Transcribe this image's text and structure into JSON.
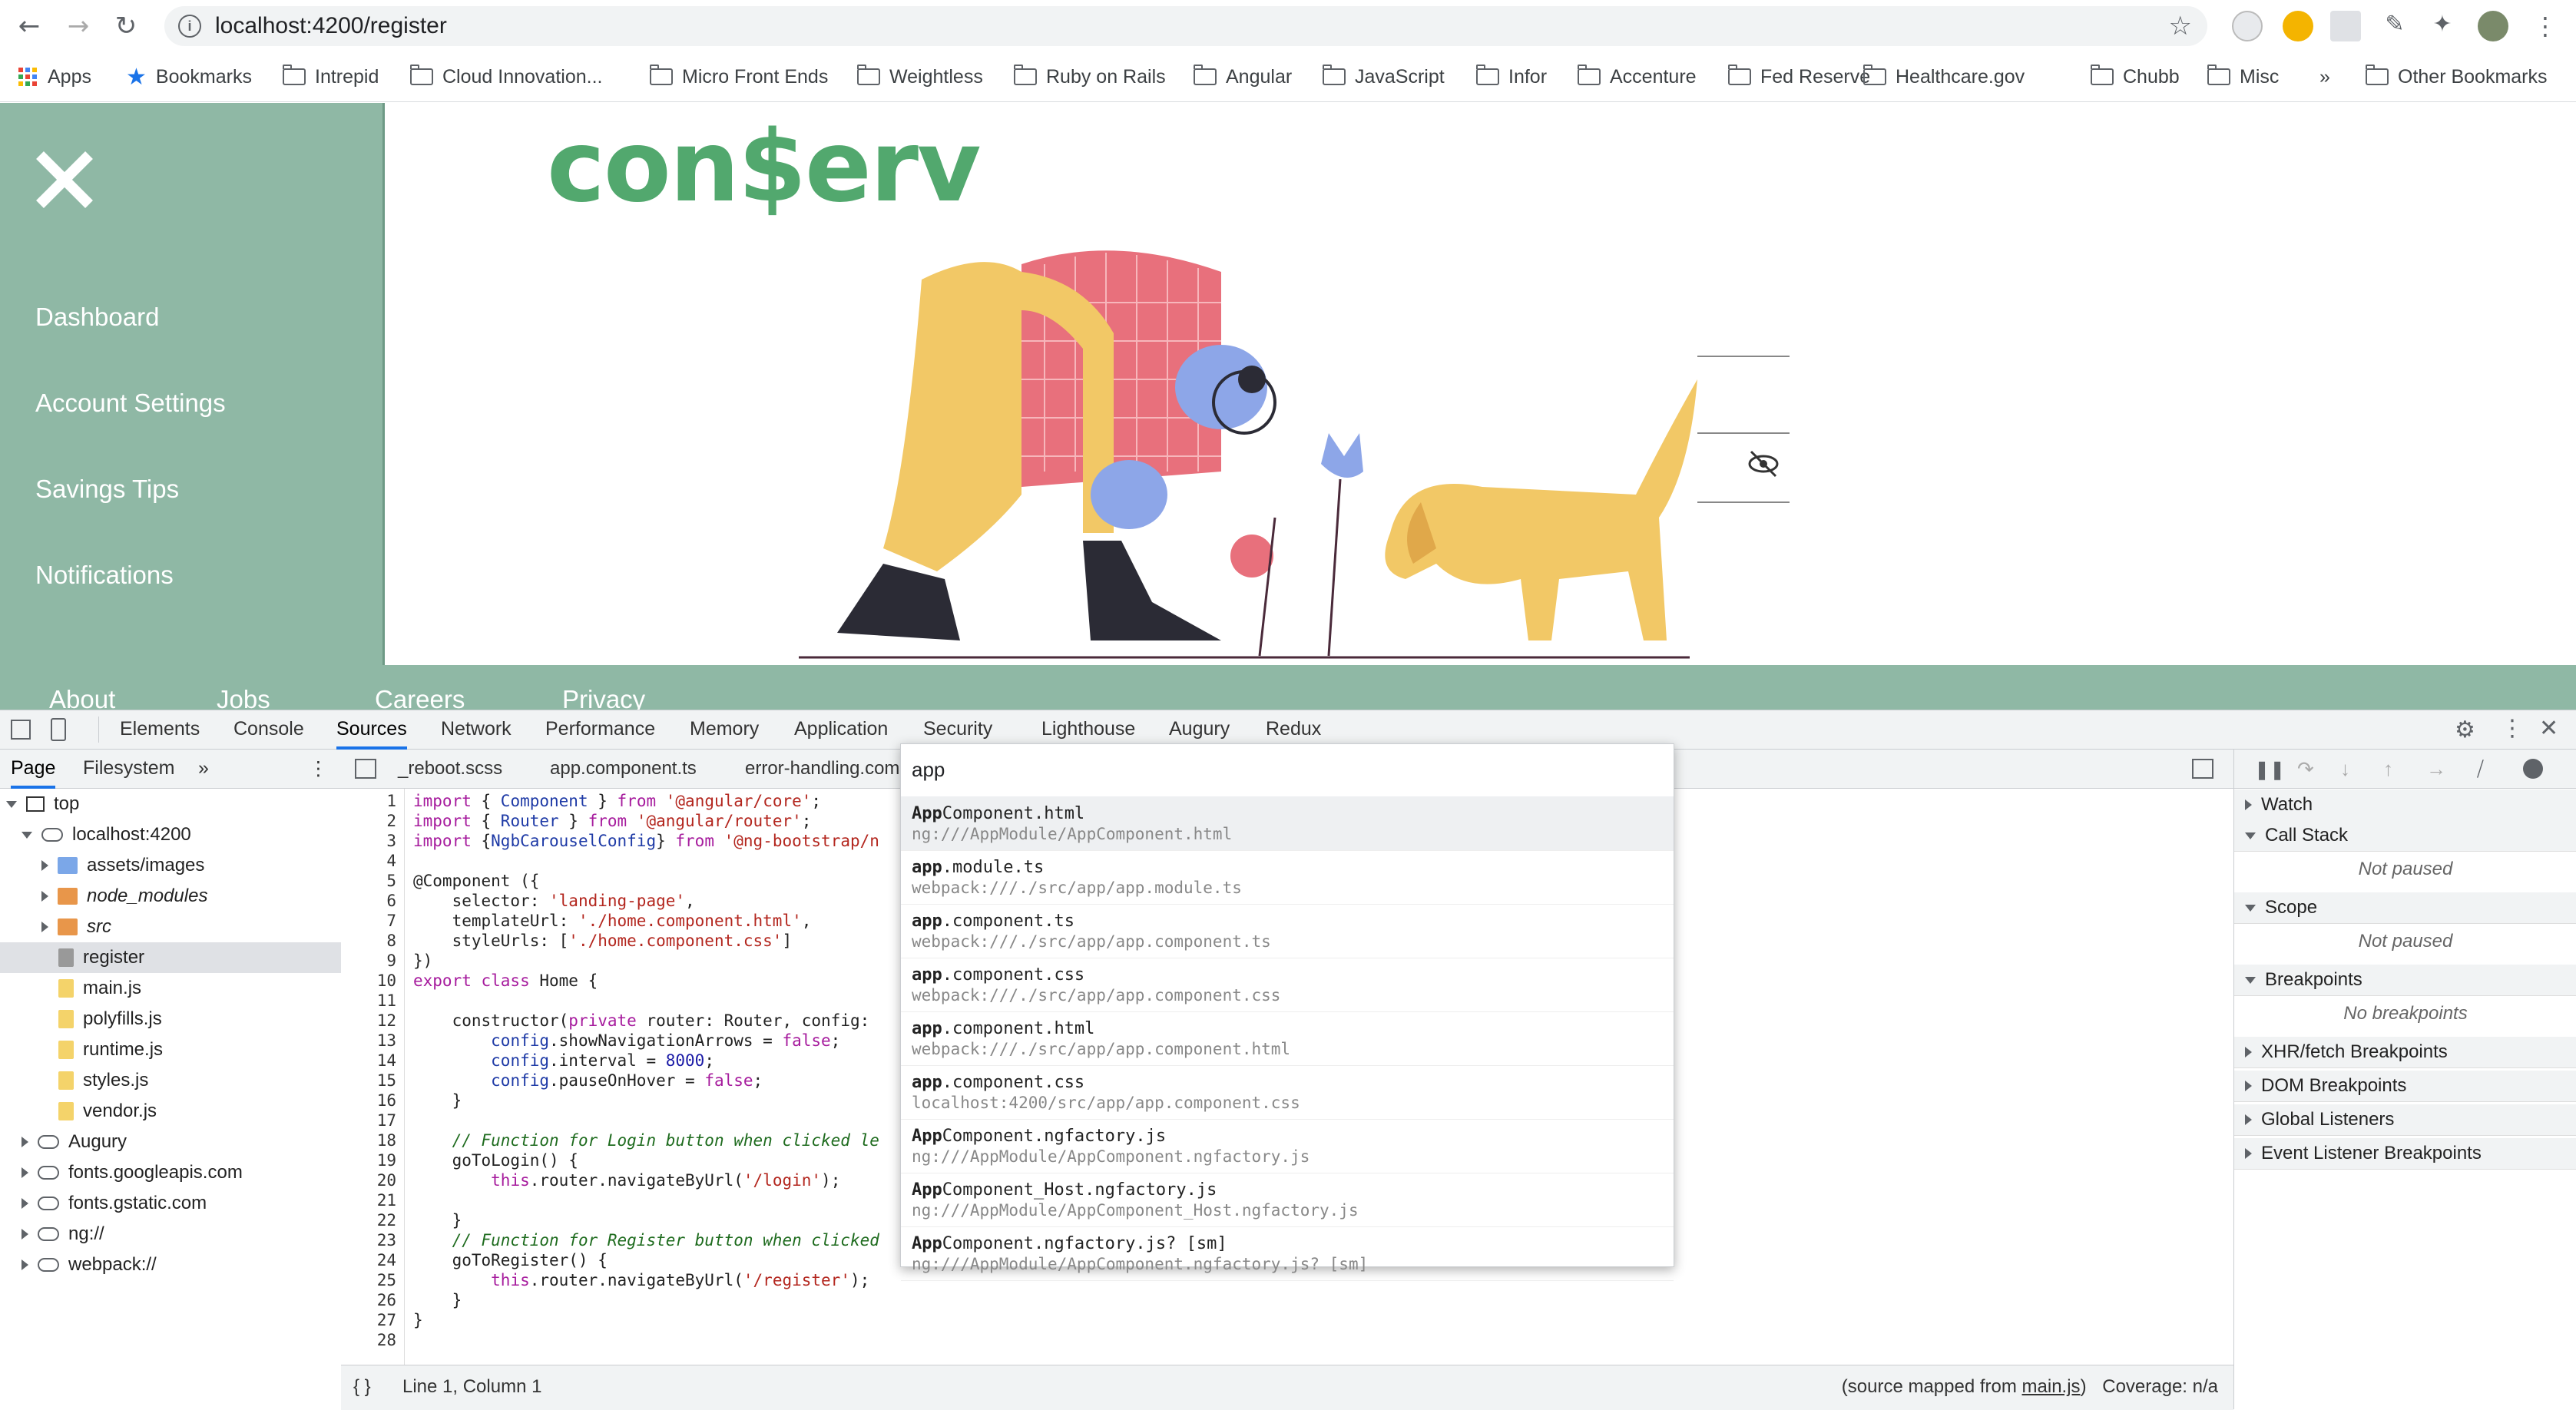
{
  "browser": {
    "url": "localhost:4200/register",
    "bookmarks": [
      "Apps",
      "Bookmarks",
      "Intrepid",
      "Cloud Innovation...",
      "Micro Front Ends",
      "Weightless",
      "Ruby on Rails",
      "Angular",
      "JavaScript",
      "Infor",
      "Accenture",
      "Fed Reserve",
      "Healthcare.gov",
      "Chubb",
      "Misc"
    ],
    "more_bookmarks": "»",
    "other_bookmarks": "Other Bookmarks"
  },
  "page": {
    "logo": "con$erv",
    "nav": [
      "Dashboard",
      "Account Settings",
      "Savings Tips",
      "Notifications"
    ],
    "footer": [
      "About",
      "Jobs",
      "Careers",
      "Privacy"
    ]
  },
  "devtools": {
    "tabs": [
      "Elements",
      "Console",
      "Sources",
      "Network",
      "Performance",
      "Memory",
      "Application",
      "Security",
      "Lighthouse",
      "Augury",
      "Redux"
    ],
    "active_tab": "Sources",
    "left_tabs": [
      "Page",
      "Filesystem"
    ],
    "left_more": "»",
    "tree": {
      "top": "top",
      "host": "localhost:4200",
      "folders": [
        "assets/images",
        "node_modules",
        "src"
      ],
      "files": [
        "register",
        "main.js",
        "polyfills.js",
        "runtime.js",
        "styles.js",
        "vendor.js"
      ],
      "origins": [
        "Augury",
        "fonts.googleapis.com",
        "fonts.gstatic.com",
        "ng://",
        "webpack://"
      ]
    },
    "editor_tabs": [
      "_reboot.scss",
      "app.component.ts",
      "error-handling.com"
    ],
    "code_lines": [
      "1",
      "2",
      "3",
      "4",
      "5",
      "6",
      "7",
      "8",
      "9",
      "10",
      "11",
      "12",
      "13",
      "14",
      "15",
      "16",
      "17",
      "18",
      "19",
      "20",
      "21",
      "22",
      "23",
      "24",
      "25",
      "26",
      "27",
      "28"
    ],
    "status": {
      "braces": "{ }",
      "position": "Line 1, Column 1",
      "source_mapped_prefix": "(source mapped from ",
      "source_mapped_file": "main.js",
      "source_mapped_suffix": ")",
      "coverage": "Coverage: n/a"
    },
    "right": {
      "sections": [
        "Watch",
        "Call Stack",
        "Scope",
        "Breakpoints",
        "XHR/fetch Breakpoints",
        "DOM Breakpoints",
        "Global Listeners",
        "Event Listener Breakpoints"
      ],
      "not_paused": "Not paused",
      "no_breakpoints": "No breakpoints"
    },
    "quick_open": {
      "query": "app",
      "items": [
        {
          "bold": "App",
          "rest": "Component.html",
          "sub": "ng:///AppModule/AppComponent.html"
        },
        {
          "bold": "app",
          "rest": ".module.ts",
          "sub": "webpack:///./src/app/app.module.ts"
        },
        {
          "bold": "app",
          "rest": ".component.ts",
          "sub": "webpack:///./src/app/app.component.ts"
        },
        {
          "bold": "app",
          "rest": ".component.css",
          "sub": "webpack:///./src/app/app.component.css"
        },
        {
          "bold": "app",
          "rest": ".component.html",
          "sub": "webpack:///./src/app/app.component.html"
        },
        {
          "bold": "app",
          "rest": ".component.css",
          "sub": "localhost:4200/src/app/app.component.css"
        },
        {
          "bold": "App",
          "rest": "Component.ngfactory.js",
          "sub": "ng:///AppModule/AppComponent.ngfactory.js"
        },
        {
          "bold": "App",
          "rest": "Component_Host.ngfactory.js",
          "sub": "ng:///AppModule/AppComponent_Host.ngfactory.js"
        },
        {
          "bold": "App",
          "rest": "Component.ngfactory.js? [sm]",
          "sub": "ng:///AppModule/AppComponent.ngfactory.js? [sm]"
        }
      ]
    }
  },
  "colors": {
    "sidebar": "#8fb8a5",
    "logo": "#52a86e",
    "accent": "#1a73e8"
  }
}
